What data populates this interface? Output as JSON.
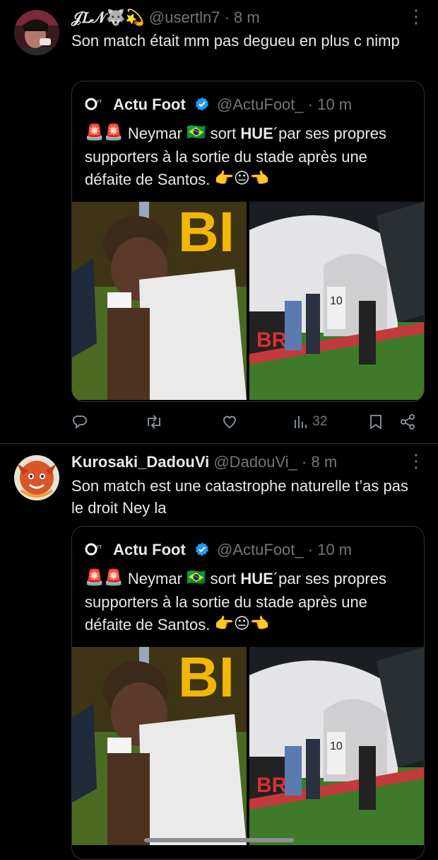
{
  "tweets": [
    {
      "display_name": "𝒥𝐿𝒩🐺💫",
      "handle": "@usertln7",
      "time": "· 8 m",
      "text": "Son match était mm pas degueu en plus c nimp",
      "quote": {
        "name": "Actu Foot",
        "handle": "@ActuFoot_",
        "time": "· 10 m",
        "text_pre": "Neymar ",
        "text_mid": " sort ",
        "text_bold": "HUE",
        "text_post": "´par ses propres supporters à la sortie du stade après une défaite de Santos. ",
        "emojis_start": "🚨🚨",
        "flag": "🇧🇷",
        "emojis_end": "👉😐👈"
      },
      "stats": {
        "views": "32"
      }
    },
    {
      "display_name": "Kurosaki_DadouVi",
      "handle": "@DadouVi_",
      "time": "· 8 m",
      "text": "Son match est une catastrophe naturelle t’as pas le droit Ney la",
      "quote": {
        "name": "Actu Foot",
        "handle": "@ActuFoot_",
        "time": "· 10 m",
        "text_pre": "Neymar ",
        "text_mid": " sort ",
        "text_bold": "HUE",
        "text_post": "´par ses propres supporters à la sortie du stade après une défaite de Santos. ",
        "emojis_start": "🚨🚨",
        "flag": "🇧🇷",
        "emojis_end": "👉😐👈"
      }
    }
  ],
  "media_text": {
    "sponsor_left": "BI",
    "sponsor_right": "BR",
    "jersey_number": "10"
  },
  "icons": {
    "reply": "reply-icon",
    "retweet": "retweet-icon",
    "like": "heart-icon",
    "views": "views-icon",
    "bookmark": "bookmark-icon",
    "share": "share-icon",
    "more": "more-icon",
    "verified": "verified-badge-icon"
  },
  "colors": {
    "background": "#000000",
    "text": "#e7e9ea",
    "muted": "#71767b",
    "border": "#2f3336",
    "verified": "#1d9bf0"
  }
}
